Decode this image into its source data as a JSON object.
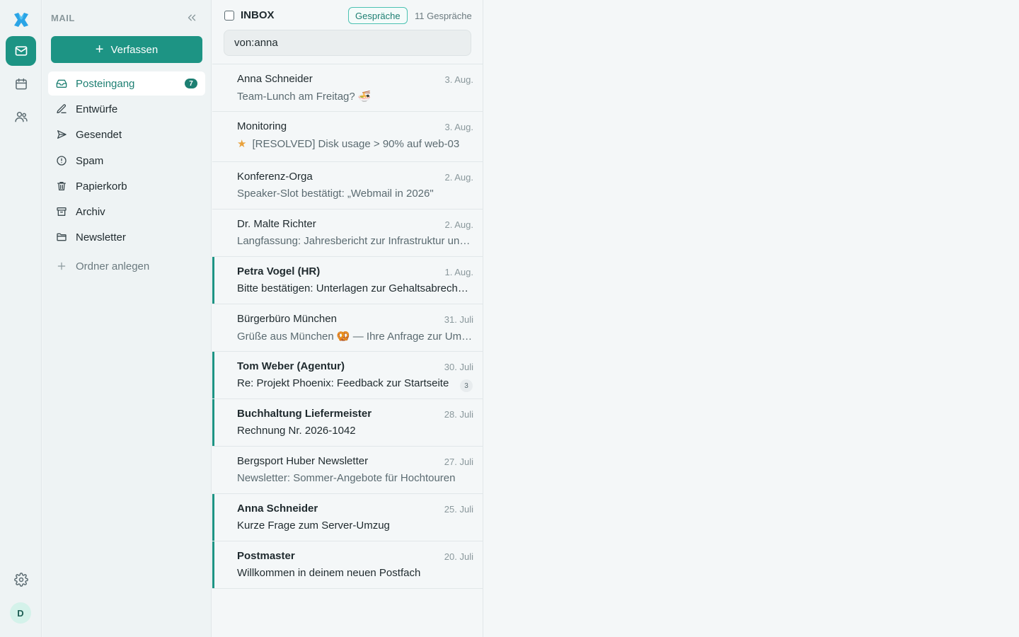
{
  "rail": {
    "avatar_initial": "D"
  },
  "sidebar": {
    "section_label": "MAIL",
    "compose_label": "Verfassen",
    "folders": [
      {
        "label": "Posteingang",
        "icon": "inbox-icon",
        "badge": "7",
        "active": true
      },
      {
        "label": "Entwürfe",
        "icon": "pencil-icon"
      },
      {
        "label": "Gesendet",
        "icon": "send-icon"
      },
      {
        "label": "Spam",
        "icon": "alert-circle-icon"
      },
      {
        "label": "Papierkorb",
        "icon": "trash-icon"
      },
      {
        "label": "Archiv",
        "icon": "archive-icon"
      },
      {
        "label": "Newsletter",
        "icon": "folder-icon"
      }
    ],
    "new_folder_label": "Ordner anlegen"
  },
  "list": {
    "title": "INBOX",
    "view_chip": "Gespräche",
    "count_label": "11 Gespräche",
    "search_value": "von:anna",
    "messages": [
      {
        "sender": "Anna Schneider",
        "date": "3. Aug.",
        "subject": "Team-Lunch am Freitag? 🍜",
        "unread": false
      },
      {
        "sender": "Monitoring",
        "date": "3. Aug.",
        "subject": "[RESOLVED] Disk usage > 90% auf web-03",
        "unread": false,
        "starred": true
      },
      {
        "sender": "Konferenz-Orga",
        "date": "2. Aug.",
        "subject": "Speaker-Slot bestätigt: „Webmail in 2026\"",
        "unread": false
      },
      {
        "sender": "Dr. Malte Richter",
        "date": "2. Aug.",
        "subject": "Langfassung: Jahresbericht zur Infrastruktur und Betrieb",
        "unread": false
      },
      {
        "sender": "Petra Vogel (HR)",
        "date": "1. Aug.",
        "subject": "Bitte bestätigen: Unterlagen zur Gehaltsabrechnung",
        "unread": true
      },
      {
        "sender": "Bürgerbüro München",
        "date": "31. Juli",
        "subject": "Grüße aus München 🥨 — Ihre Anfrage zur Ummeldung",
        "unread": false
      },
      {
        "sender": "Tom Weber (Agentur)",
        "date": "30. Juli",
        "subject": "Re: Projekt Phoenix: Feedback zur Startseite",
        "unread": true,
        "thread_count": "3"
      },
      {
        "sender": "Buchhaltung Liefermeister",
        "date": "28. Juli",
        "subject": "Rechnung Nr. 2026-1042",
        "unread": true
      },
      {
        "sender": "Bergsport Huber Newsletter",
        "date": "27. Juli",
        "subject": "Newsletter: Sommer-Angebote für Hochtouren",
        "unread": false
      },
      {
        "sender": "Anna Schneider",
        "date": "25. Juli",
        "subject": "Kurze Frage zum Server-Umzug",
        "unread": true
      },
      {
        "sender": "Postmaster",
        "date": "20. Juli",
        "subject": "Willkommen in deinem neuen Postfach",
        "unread": true
      }
    ]
  },
  "colors": {
    "accent": "#1d9484",
    "accent_dark": "#1d7f72",
    "star": "#e9a13b"
  }
}
